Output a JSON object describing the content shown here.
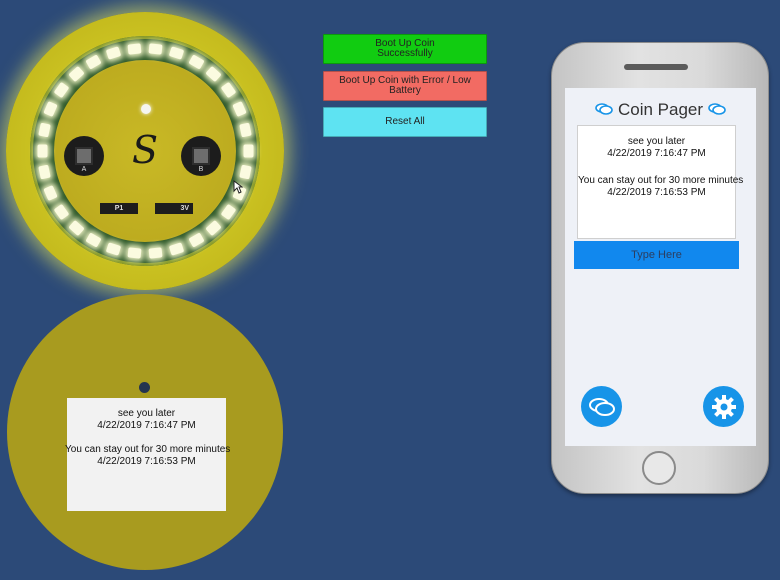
{
  "coin": {
    "button_a_label": "A",
    "button_b_label": "B",
    "pad_p1_label": "P1",
    "pad_3v_label": "3V",
    "logo_glyph": "S"
  },
  "coin_screen": {
    "line1": "see you later",
    "time1": "4/22/2019 7:16:47 PM",
    "line2": "You can stay out for 30 more minutes",
    "time2": "4/22/2019 7:16:53 PM"
  },
  "controls": {
    "boot_ok_label": "Boot Up Coin Successfully",
    "boot_ok_color": "#11cc11",
    "boot_error_label": "Boot Up Coin with Error / Low Battery",
    "boot_error_color": "#f26b63",
    "reset_label": "Reset All",
    "reset_color": "#5ee3f2"
  },
  "phone": {
    "app_title": "Coin Pager",
    "title_icon": "chat-bubbles-icon",
    "messages": [
      {
        "text": "see you later",
        "time": "4/22/2019 7:16:47 PM"
      },
      {
        "text": "You can stay out for 30 more minutes",
        "time": "4/22/2019 7:16:53 PM"
      }
    ],
    "input_placeholder": "Type Here",
    "chat_button_icon": "chat-icon",
    "settings_button_icon": "gear-icon"
  }
}
